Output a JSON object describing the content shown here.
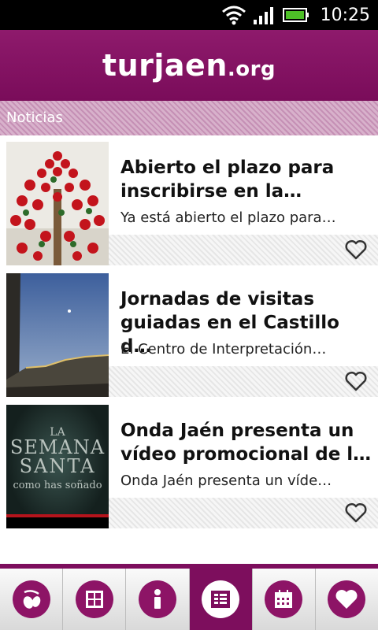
{
  "status_bar": {
    "time": "10:25"
  },
  "header": {
    "brand": "turjaen",
    "brand_suffix": ".org"
  },
  "section": {
    "title": "Noticias"
  },
  "news": [
    {
      "title_line1": "Abierto el plazo para",
      "title_line2": "inscribirse en la…",
      "excerpt": "Ya está abierto el plazo para…"
    },
    {
      "title_line1": "Jornadas de visitas",
      "title_line2": "guiadas en el Castillo d…",
      "excerpt": "El Centro de Interpretación…"
    },
    {
      "title_line1": "Onda Jaén presenta un",
      "title_line2": "vídeo promocional de l…",
      "excerpt": "Onda Jaén presenta un víde…",
      "thumb_text1": "LA",
      "thumb_text2": "SEMANA",
      "thumb_text3": "SANTA",
      "thumb_text4": "como has soñado"
    }
  ],
  "nav": {
    "icons": [
      "olive-icon",
      "checklist-icon",
      "info-icon",
      "news-icon",
      "calendar-icon",
      "heart-icon"
    ],
    "active_index": 3
  },
  "colors": {
    "brand": "#7d0e5d",
    "accent_light": "#d8b1cb"
  }
}
